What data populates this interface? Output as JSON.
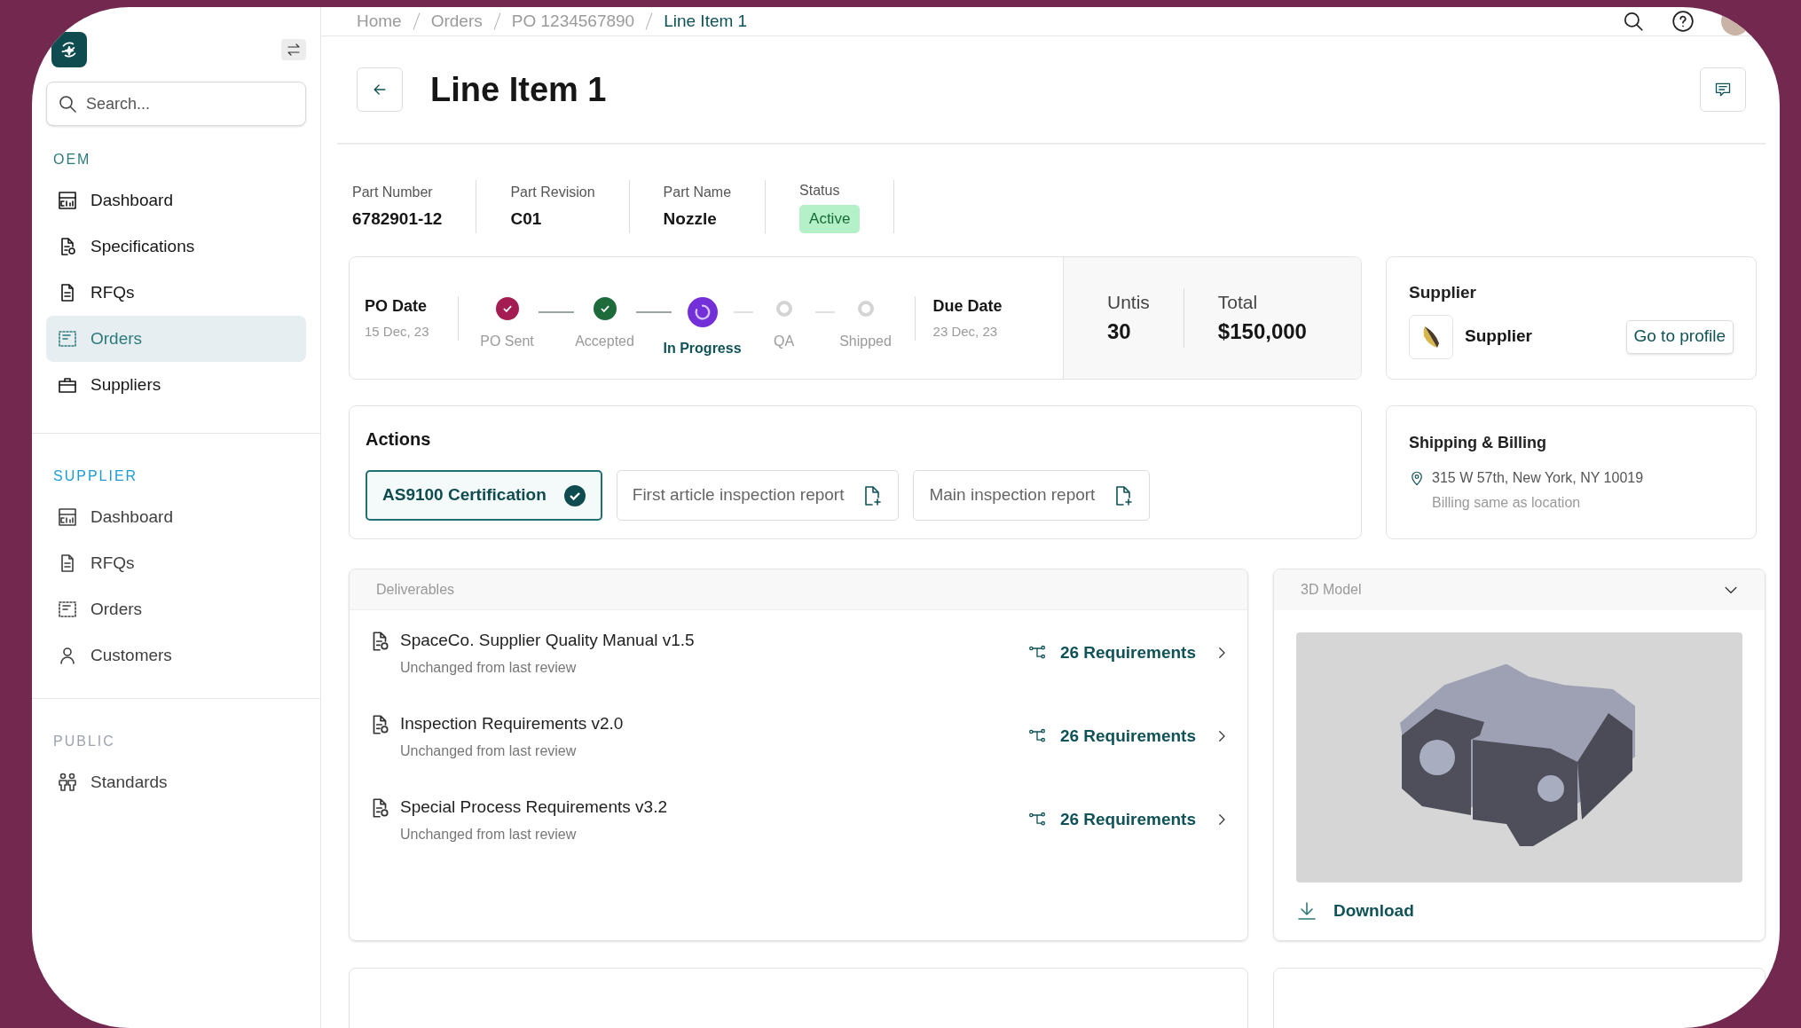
{
  "sidebar": {
    "search": {
      "placeholder": "Search..."
    },
    "sections": [
      {
        "heading": "OEM",
        "color": "#2c7a7b",
        "items": [
          {
            "label": "Dashboard",
            "selected": false
          },
          {
            "label": "Specifications",
            "selected": false
          },
          {
            "label": "RFQs",
            "selected": false
          },
          {
            "label": "Orders",
            "selected": true
          },
          {
            "label": "Suppliers",
            "selected": false
          }
        ]
      },
      {
        "heading": "SUPPLIER",
        "color": "#1e9bd7",
        "items": [
          {
            "label": "Dashboard",
            "selected": false
          },
          {
            "label": "RFQs",
            "selected": false
          },
          {
            "label": "Orders",
            "selected": false
          },
          {
            "label": "Customers",
            "selected": false
          }
        ]
      },
      {
        "heading": "PUBLIC",
        "color": "#9ca3af",
        "items": [
          {
            "label": "Standards",
            "selected": false
          }
        ]
      }
    ]
  },
  "breadcrumbs": [
    {
      "label": "Home",
      "selected": false
    },
    {
      "label": "Orders",
      "selected": false
    },
    {
      "label": "PO 1234567890",
      "selected": false
    },
    {
      "label": "Line Item 1",
      "selected": true
    }
  ],
  "title": "Line Item 1",
  "part_info": [
    {
      "label": "Part Number",
      "value": "6782901-12"
    },
    {
      "label": "Part Revision",
      "value": "C01"
    },
    {
      "label": "Part Name",
      "value": "Nozzle"
    }
  ],
  "status": {
    "label": "Status",
    "value": "Active"
  },
  "progress": {
    "po_date": {
      "label": "PO Date",
      "value": "15 Dec, 23"
    },
    "steps": [
      {
        "label": "PO Sent",
        "done": true,
        "current": false,
        "color": "#a31d52"
      },
      {
        "label": "Accepted",
        "done": true,
        "current": false,
        "color": "#1d6b3a"
      },
      {
        "label": "In Progress",
        "done": false,
        "current": true,
        "color": "#7330d9"
      },
      {
        "label": "QA",
        "done": false,
        "current": false,
        "color": "#d4d4d4"
      },
      {
        "label": "Shipped",
        "done": false,
        "current": false,
        "color": "#d4d4d4"
      }
    ],
    "due_date": {
      "label": "Due Date",
      "value": "23 Dec, 23"
    }
  },
  "totals": [
    {
      "label": "Untis",
      "value": "30"
    },
    {
      "label": "Total",
      "value": "$150,000"
    }
  ],
  "supplier": {
    "heading": "Supplier",
    "name": "Supplier",
    "button": "Go to profile"
  },
  "actions": {
    "heading": "Actions",
    "items": [
      {
        "label": "AS9100 Certification",
        "done": true
      },
      {
        "label": "First article inspection report",
        "done": false
      },
      {
        "label": "Main inspection report",
        "done": false
      }
    ]
  },
  "shipping": {
    "heading": "Shipping & Billing",
    "address": "315 W 57th, New York, NY 10019",
    "note": "Billing same as location"
  },
  "deliverables": {
    "heading": "Deliverables",
    "items": [
      {
        "title": "SpaceCo. Supplier Quality Manual v1.5",
        "subtitle": "Unchanged from last review",
        "link": "26 Requirements"
      },
      {
        "title": "Inspection Requirements v2.0",
        "subtitle": "Unchanged from last review",
        "link": "26 Requirements"
      },
      {
        "title": "Special Process Requirements v3.2",
        "subtitle": "Unchanged from last review",
        "link": "26 Requirements"
      }
    ]
  },
  "model": {
    "heading": "3D Model",
    "expanded": true,
    "download": "Download"
  }
}
